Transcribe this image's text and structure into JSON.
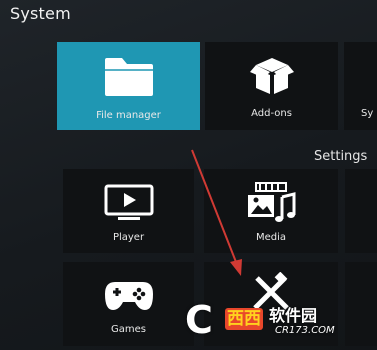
{
  "header": {
    "title": "System"
  },
  "top_row": [
    {
      "label": "File manager",
      "icon": "folder-icon",
      "focused": true
    },
    {
      "label": "Add-ons",
      "icon": "box-icon",
      "focused": false
    },
    {
      "label": "Sy",
      "icon": "system-info-icon",
      "focused": false
    }
  ],
  "settings": {
    "section_label": "Settings",
    "tiles": [
      {
        "label": "Player",
        "icon": "player-icon"
      },
      {
        "label": "Media",
        "icon": "media-icon"
      },
      {
        "label": "Games",
        "icon": "gamepad-icon"
      },
      {
        "label": "",
        "icon": "interface-icon"
      }
    ]
  },
  "colors": {
    "focus": "#1f97b3",
    "tile": "#101214",
    "annotation_arrow": "#d03a34"
  },
  "watermark": {
    "letter": "C",
    "logo": "西西",
    "site": "软件园",
    "domain": "CR173.COM"
  }
}
